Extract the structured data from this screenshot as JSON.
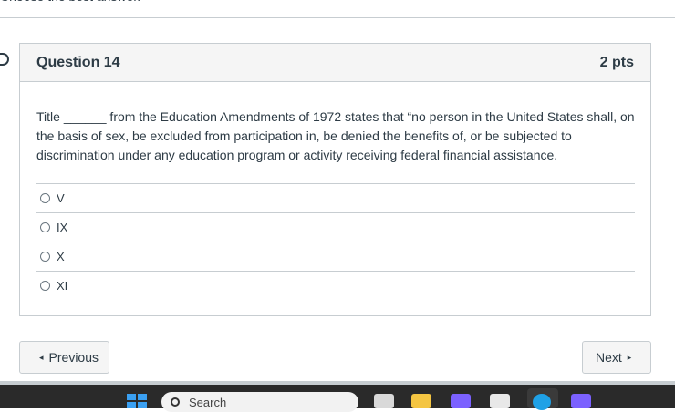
{
  "page": {
    "instructions": "Choose the best answer."
  },
  "question": {
    "title": "Question 14",
    "points": "2 pts",
    "text": "Title ______ from the Education Amendments of 1972 states that “no person in the United States shall, on the basis of sex, be excluded from participation in, be denied the benefits of, or be subjected to discrimination under any education program or activity receiving federal financial assistance.",
    "answers": [
      {
        "label": "V"
      },
      {
        "label": "IX"
      },
      {
        "label": "X"
      },
      {
        "label": "XI"
      }
    ]
  },
  "navigation": {
    "previous_label": "Previous",
    "next_label": "Next",
    "previous_arrow": "◂",
    "next_arrow": "▸"
  },
  "taskbar": {
    "search_label": "Search",
    "icons": [
      "windows-start-icon",
      "search-icon",
      "file-explorer-icon",
      "folder-icon",
      "copilot-icon",
      "store-icon",
      "edge-icon",
      "copilot-app-icon"
    ],
    "colors": {
      "windows_blue": "#3aa0f2",
      "folder_yellow": "#f4c542",
      "edge_blue": "#1fa1e6",
      "copilot_purple": "#7b61ff"
    }
  }
}
